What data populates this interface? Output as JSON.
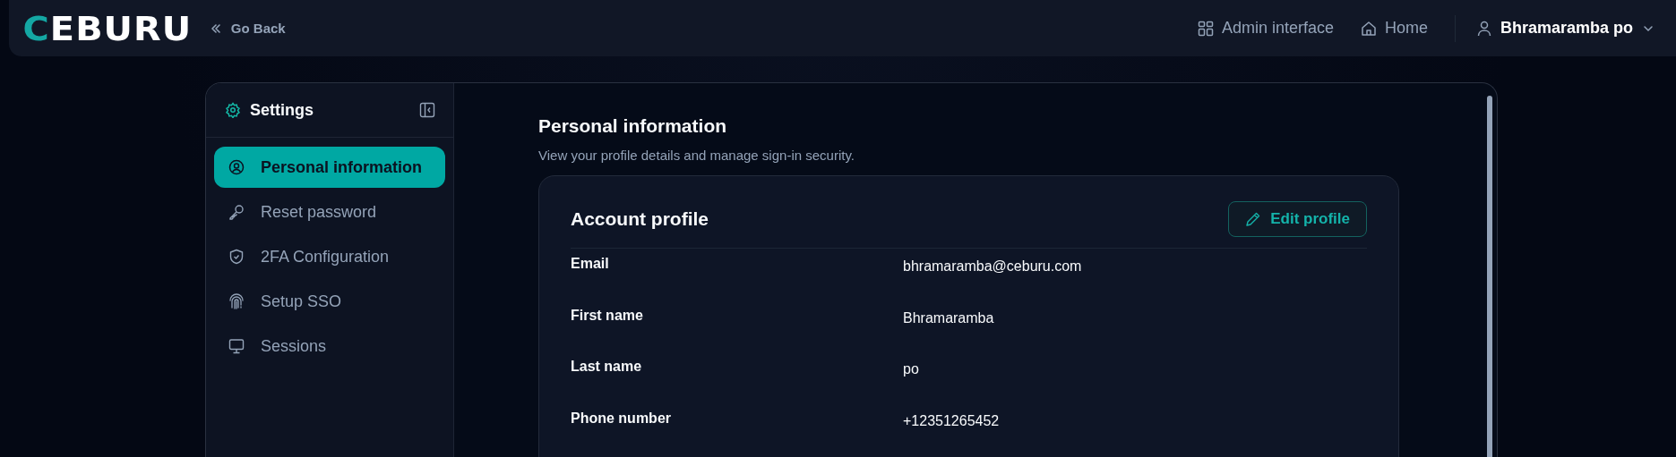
{
  "header": {
    "logo": "CEBURU",
    "back_link": "Go Back",
    "nav": [
      {
        "kind": "admin",
        "label": "Admin interface"
      },
      {
        "kind": "home",
        "label": "Home"
      }
    ],
    "user": "Bhramaramba po"
  },
  "sidebar": {
    "title": "Settings",
    "items": [
      {
        "kind": "user",
        "label": "Personal information",
        "selected": true
      },
      {
        "kind": "key",
        "label": "Reset password",
        "selected": false
      },
      {
        "kind": "shield",
        "label": "2FA Configuration",
        "selected": false
      },
      {
        "kind": "fingerprint",
        "label": "Setup SSO",
        "selected": false
      },
      {
        "kind": "monitor",
        "label": "Sessions",
        "selected": false
      }
    ]
  },
  "page": {
    "title": "Personal information",
    "subtitle": "View your profile details and manage sign-in security."
  },
  "card": {
    "title": "Account profile",
    "edit_button": "Edit profile",
    "fields": [
      {
        "label": "Email",
        "value": "bhramaramba@ceburu.com"
      },
      {
        "label": "First name",
        "value": "Bhramaramba"
      },
      {
        "label": "Last name",
        "value": "po"
      },
      {
        "label": "Phone number",
        "value": "+12351265452"
      }
    ]
  }
}
